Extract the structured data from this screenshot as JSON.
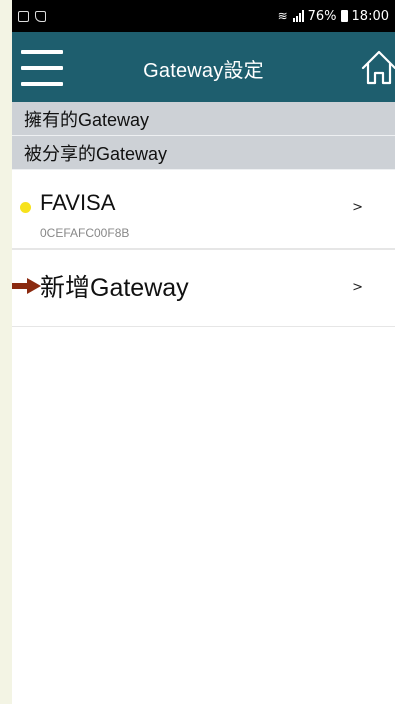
{
  "status_bar": {
    "battery": "76%",
    "time": "18:00",
    "left_icons": [
      "image-notification-icon",
      "notification-icon"
    ],
    "right_icons": [
      "wifi-icon",
      "signal-icon",
      "battery-icon"
    ]
  },
  "header": {
    "title": "Gateway設定",
    "menu_icon": "hamburger-menu-icon",
    "home_icon": "home-icon",
    "background": "#1e5e6e"
  },
  "sections": {
    "owned": "擁有的Gateway",
    "shared": "被分享的Gateway"
  },
  "devices": [
    {
      "name": "FAVISA",
      "id": "0CEFAFC00F8B",
      "status_color": "#f7e21c",
      "chevron": ">"
    }
  ],
  "add_gateway": {
    "label": "新增Gateway",
    "chevron": ">",
    "arrow_color": "#8b2a10"
  }
}
